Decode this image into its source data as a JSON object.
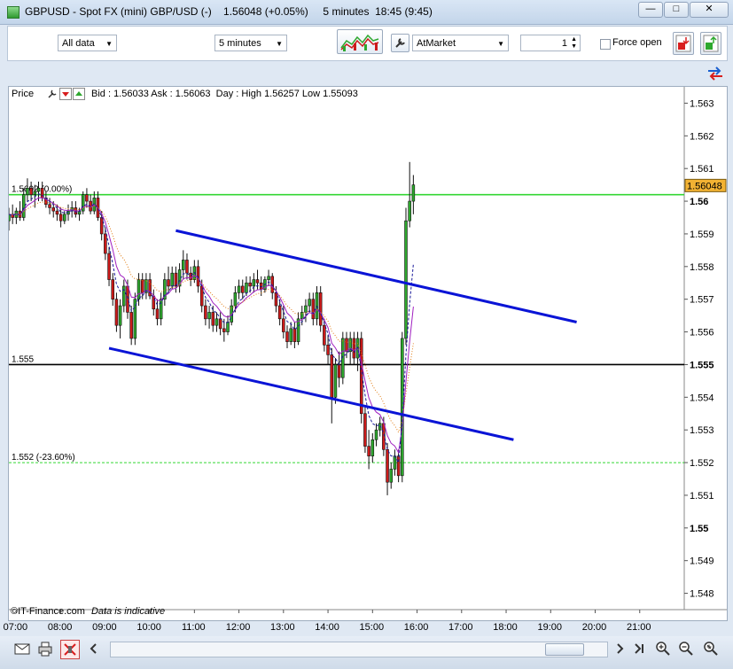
{
  "window": {
    "title": "GBPUSD - Spot FX (mini) GBP/USD (-)    1.56048 (+0.05%)     5 minutes  18:45 (9:45)",
    "min_label": "—",
    "max_label": "□",
    "close_label": "✕"
  },
  "toolbar": {
    "data_select": "All data",
    "interval_select": "5 minutes",
    "order_type_select": "AtMarket",
    "quantity": "1",
    "force_open_label": "Force open"
  },
  "chart_header": {
    "panel_label": "Price",
    "quote_line": "Bid : 1.56033 Ask : 1.56063  Day : High 1.56257 Low 1.55093"
  },
  "footer": {
    "credit": "©IT-Finance.com",
    "note": "Data is indicative"
  },
  "colors": {
    "up": "#2ea82e",
    "down": "#cc1a1a",
    "trendline": "#0a14d6",
    "level_green": "#33d633",
    "level_black": "#000000",
    "ma_purple": "#a020c0",
    "ma_orange": "#e07a10",
    "ma_navy": "#1a1a9a",
    "last_price_bg": "#f2b233"
  },
  "chart_data": {
    "type": "candlestick",
    "symbol": "GBPUSD",
    "interval": "5 minutes",
    "x_tick_labels": [
      "07:00",
      "08:00",
      "09:00",
      "10:00",
      "11:00",
      "12:00",
      "13:00",
      "14:00",
      "15:00",
      "16:00",
      "17:00",
      "18:00",
      "19:00",
      "20:00",
      "21:00"
    ],
    "y_tick_labels": [
      "1.563",
      "1.562",
      "1.561",
      "1.56",
      "1.559",
      "1.558",
      "1.557",
      "1.556",
      "1.555",
      "1.554",
      "1.553",
      "1.552",
      "1.551",
      "1.55",
      "1.549",
      "1.548"
    ],
    "bold_y_ticks": [
      "1.56",
      "1.555",
      "1.55"
    ],
    "x_range": [
      "06:50",
      "22:00"
    ],
    "y_range": [
      1.5475,
      1.5635
    ],
    "last_price": "1.56048",
    "levels": [
      {
        "value": 1.5602,
        "label": "1.5602 (0.00%)",
        "style": "solid",
        "color": "#33d633"
      },
      {
        "value": 1.555,
        "label": "1.555",
        "style": "solid",
        "color": "#000000"
      },
      {
        "value": 1.552,
        "label": "1.552 (-23.60%)",
        "style": "dashed",
        "color": "#33d633"
      }
    ],
    "trendlines": [
      {
        "x1": "10:35",
        "y1": 1.5591,
        "x2": "19:35",
        "y2": 1.5563
      },
      {
        "x1": "09:05",
        "y1": 1.5555,
        "x2": "18:10",
        "y2": 1.5527
      }
    ],
    "candles": {
      "start": "06:50",
      "step_minutes": 5,
      "ohlc": [
        [
          1.5594,
          1.5598,
          1.5591,
          1.5596
        ],
        [
          1.5596,
          1.5599,
          1.5593,
          1.5595
        ],
        [
          1.5595,
          1.5598,
          1.5593,
          1.5597
        ],
        [
          1.5597,
          1.56,
          1.5594,
          1.5595
        ],
        [
          1.5595,
          1.5604,
          1.5594,
          1.5602
        ],
        [
          1.5602,
          1.5607,
          1.56,
          1.5604
        ],
        [
          1.5604,
          1.5606,
          1.56,
          1.5602
        ],
        [
          1.5602,
          1.5605,
          1.5598,
          1.5603
        ],
        [
          1.5603,
          1.5606,
          1.56,
          1.5604
        ],
        [
          1.5604,
          1.5606,
          1.56,
          1.5601
        ],
        [
          1.5601,
          1.5603,
          1.5598,
          1.5599
        ],
        [
          1.5599,
          1.5601,
          1.5596,
          1.5598
        ],
        [
          1.5598,
          1.56,
          1.5595,
          1.5597
        ],
        [
          1.5597,
          1.5599,
          1.5594,
          1.5596
        ],
        [
          1.5596,
          1.5598,
          1.5592,
          1.5594
        ],
        [
          1.5594,
          1.5597,
          1.5593,
          1.5596
        ],
        [
          1.5596,
          1.5599,
          1.5594,
          1.5597
        ],
        [
          1.5597,
          1.56,
          1.5595,
          1.5598
        ],
        [
          1.5598,
          1.56,
          1.5595,
          1.5596
        ],
        [
          1.5596,
          1.5598,
          1.5594,
          1.5597
        ],
        [
          1.5597,
          1.5603,
          1.5596,
          1.5602
        ],
        [
          1.5602,
          1.5604,
          1.5598,
          1.56
        ],
        [
          1.56,
          1.5602,
          1.5596,
          1.5597
        ],
        [
          1.5597,
          1.5603,
          1.5596,
          1.5601
        ],
        [
          1.5601,
          1.5603,
          1.5594,
          1.5595
        ],
        [
          1.5595,
          1.5597,
          1.5588,
          1.559
        ],
        [
          1.559,
          1.5592,
          1.5582,
          1.5584
        ],
        [
          1.5584,
          1.5586,
          1.5574,
          1.5576
        ],
        [
          1.5576,
          1.5578,
          1.5568,
          1.557
        ],
        [
          1.557,
          1.5572,
          1.556,
          1.5562
        ],
        [
          1.5562,
          1.557,
          1.5558,
          1.5568
        ],
        [
          1.5568,
          1.5576,
          1.5566,
          1.5574
        ],
        [
          1.5574,
          1.5576,
          1.5564,
          1.5566
        ],
        [
          1.5566,
          1.5568,
          1.5556,
          1.5558
        ],
        [
          1.5558,
          1.5572,
          1.5556,
          1.557
        ],
        [
          1.557,
          1.5578,
          1.5568,
          1.5576
        ],
        [
          1.5576,
          1.5578,
          1.557,
          1.5572
        ],
        [
          1.5572,
          1.5578,
          1.557,
          1.5576
        ],
        [
          1.5576,
          1.5578,
          1.557,
          1.5571
        ],
        [
          1.5571,
          1.5573,
          1.5565,
          1.5567
        ],
        [
          1.5567,
          1.557,
          1.5562,
          1.5564
        ],
        [
          1.5564,
          1.5572,
          1.5562,
          1.557
        ],
        [
          1.557,
          1.5578,
          1.5568,
          1.5576
        ],
        [
          1.5576,
          1.558,
          1.5572,
          1.5574
        ],
        [
          1.5574,
          1.558,
          1.5573,
          1.5578
        ],
        [
          1.5578,
          1.558,
          1.5572,
          1.5574
        ],
        [
          1.5574,
          1.5581,
          1.5572,
          1.5579
        ],
        [
          1.5579,
          1.5585,
          1.5576,
          1.5582
        ],
        [
          1.5582,
          1.5584,
          1.5576,
          1.5578
        ],
        [
          1.5578,
          1.558,
          1.5574,
          1.5576
        ],
        [
          1.5576,
          1.5582,
          1.5575,
          1.558
        ],
        [
          1.558,
          1.5582,
          1.5572,
          1.5574
        ],
        [
          1.5574,
          1.5576,
          1.5566,
          1.5568
        ],
        [
          1.5568,
          1.557,
          1.5562,
          1.5564
        ],
        [
          1.5564,
          1.5568,
          1.5561,
          1.5566
        ],
        [
          1.5566,
          1.5568,
          1.556,
          1.5562
        ],
        [
          1.5562,
          1.5566,
          1.556,
          1.5564
        ],
        [
          1.5564,
          1.5566,
          1.5559,
          1.5561
        ],
        [
          1.5561,
          1.5564,
          1.5557,
          1.556
        ],
        [
          1.556,
          1.5565,
          1.5559,
          1.5563
        ],
        [
          1.5563,
          1.557,
          1.5562,
          1.5568
        ],
        [
          1.5568,
          1.5574,
          1.5566,
          1.5572
        ],
        [
          1.5572,
          1.5576,
          1.557,
          1.5574
        ],
        [
          1.5574,
          1.5576,
          1.557,
          1.5572
        ],
        [
          1.5572,
          1.5577,
          1.5571,
          1.5575
        ],
        [
          1.5575,
          1.5577,
          1.5572,
          1.5574
        ],
        [
          1.5574,
          1.5578,
          1.5572,
          1.5576
        ],
        [
          1.5576,
          1.5579,
          1.5573,
          1.5575
        ],
        [
          1.5575,
          1.5577,
          1.5571,
          1.5573
        ],
        [
          1.5573,
          1.5577,
          1.5572,
          1.5576
        ],
        [
          1.5576,
          1.5579,
          1.5574,
          1.5577
        ],
        [
          1.5577,
          1.5578,
          1.557,
          1.5572
        ],
        [
          1.5572,
          1.5574,
          1.5566,
          1.5568
        ],
        [
          1.5568,
          1.557,
          1.5562,
          1.5564
        ],
        [
          1.5564,
          1.5568,
          1.5558,
          1.556
        ],
        [
          1.556,
          1.5562,
          1.5555,
          1.5557
        ],
        [
          1.5557,
          1.5563,
          1.5556,
          1.5561
        ],
        [
          1.5561,
          1.5563,
          1.5555,
          1.5557
        ],
        [
          1.5557,
          1.5566,
          1.5556,
          1.5564
        ],
        [
          1.5564,
          1.5568,
          1.5562,
          1.5566
        ],
        [
          1.5566,
          1.557,
          1.5563,
          1.5568
        ],
        [
          1.5568,
          1.5572,
          1.5566,
          1.557
        ],
        [
          1.557,
          1.5572,
          1.5562,
          1.5564
        ],
        [
          1.5564,
          1.5574,
          1.5562,
          1.5572
        ],
        [
          1.5572,
          1.5574,
          1.556,
          1.5562
        ],
        [
          1.5562,
          1.5564,
          1.5554,
          1.5556
        ],
        [
          1.5556,
          1.5559,
          1.555,
          1.5553
        ],
        [
          1.5553,
          1.5555,
          1.5532,
          1.554
        ],
        [
          1.554,
          1.5552,
          1.5538,
          1.555
        ],
        [
          1.555,
          1.5554,
          1.5543,
          1.5546
        ],
        [
          1.5546,
          1.556,
          1.5544,
          1.5558
        ],
        [
          1.5558,
          1.556,
          1.5552,
          1.5554
        ],
        [
          1.5554,
          1.556,
          1.555,
          1.5558
        ],
        [
          1.5558,
          1.556,
          1.555,
          1.5552
        ],
        [
          1.5552,
          1.556,
          1.5548,
          1.5558
        ],
        [
          1.5558,
          1.556,
          1.5532,
          1.5535
        ],
        [
          1.5535,
          1.5537,
          1.5523,
          1.5525
        ],
        [
          1.5525,
          1.553,
          1.5518,
          1.5522
        ],
        [
          1.5522,
          1.5529,
          1.552,
          1.5527
        ],
        [
          1.5527,
          1.5532,
          1.5525,
          1.553
        ],
        [
          1.553,
          1.5534,
          1.5528,
          1.5532
        ],
        [
          1.5532,
          1.5534,
          1.5522,
          1.5524
        ],
        [
          1.5524,
          1.5526,
          1.551,
          1.5514
        ],
        [
          1.5514,
          1.552,
          1.5512,
          1.5518
        ],
        [
          1.5518,
          1.5524,
          1.5516,
          1.5522
        ],
        [
          1.5522,
          1.5524,
          1.5514,
          1.5516
        ],
        [
          1.5516,
          1.556,
          1.5514,
          1.5558
        ],
        [
          1.5558,
          1.5598,
          1.5556,
          1.5594
        ],
        [
          1.5594,
          1.5612,
          1.5592,
          1.56
        ],
        [
          1.56,
          1.5608,
          1.5596,
          1.5605
        ]
      ]
    },
    "moving_averages": [
      {
        "color": "#a020c0",
        "style": "solid"
      },
      {
        "color": "#e07a10",
        "style": "dotted"
      },
      {
        "color": "#1a1a9a",
        "style": "dashed"
      }
    ],
    "grid": false
  }
}
